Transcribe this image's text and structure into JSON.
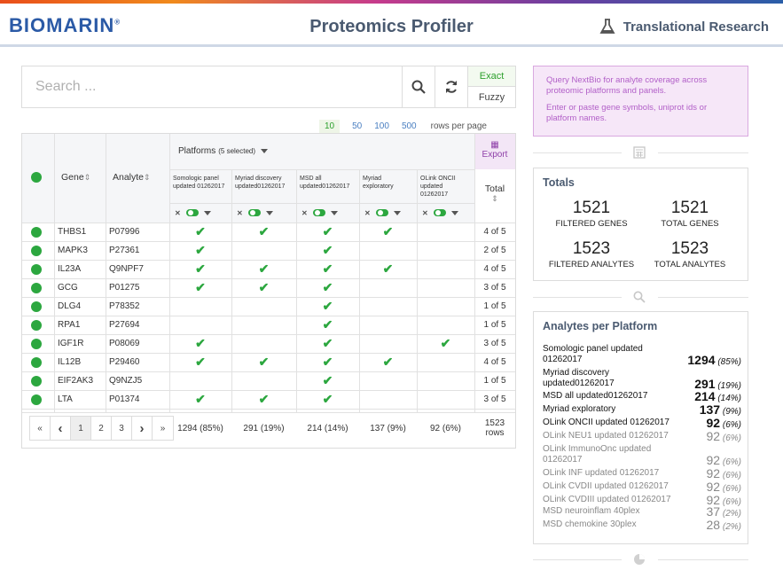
{
  "header": {
    "logo": "BIOMARIN",
    "logo_mark": "®",
    "title": "Proteomics Profiler",
    "right_label": "Translational Research"
  },
  "search": {
    "placeholder": "Search ...",
    "exact_label": "Exact",
    "fuzzy_label": "Fuzzy"
  },
  "rows_per_page": {
    "options": [
      "10",
      "50",
      "100",
      "500"
    ],
    "label": "rows per page"
  },
  "table": {
    "col_gene": "Gene",
    "col_analyte": "Analyte",
    "platforms_label": "Platforms",
    "platforms_selected": "(5 selected)",
    "export_label": "Export",
    "total_label": "Total",
    "platforms": [
      "Somologic panel updated 01262017",
      "Myriad discovery updated01262017",
      "MSD all updated01262017",
      "Myriad exploratory",
      "OLink ONCII updated 01262017"
    ],
    "rows": [
      {
        "gene": "THBS1",
        "analyte": "P07996",
        "checks": [
          1,
          1,
          1,
          1,
          0
        ],
        "total": "4 of 5"
      },
      {
        "gene": "MAPK3",
        "analyte": "P27361",
        "checks": [
          1,
          0,
          1,
          0,
          0
        ],
        "total": "2 of 5"
      },
      {
        "gene": "IL23A",
        "analyte": "Q9NPF7",
        "checks": [
          1,
          1,
          1,
          1,
          0
        ],
        "total": "4 of 5"
      },
      {
        "gene": "GCG",
        "analyte": "P01275",
        "checks": [
          1,
          1,
          1,
          0,
          0
        ],
        "total": "3 of 5"
      },
      {
        "gene": "DLG4",
        "analyte": "P78352",
        "checks": [
          0,
          0,
          1,
          0,
          0
        ],
        "total": "1 of 5"
      },
      {
        "gene": "RPA1",
        "analyte": "P27694",
        "checks": [
          0,
          0,
          1,
          0,
          0
        ],
        "total": "1 of 5"
      },
      {
        "gene": "IGF1R",
        "analyte": "P08069",
        "checks": [
          1,
          0,
          1,
          0,
          1
        ],
        "total": "3 of 5"
      },
      {
        "gene": "IL12B",
        "analyte": "P29460",
        "checks": [
          1,
          1,
          1,
          1,
          0
        ],
        "total": "4 of 5"
      },
      {
        "gene": "EIF2AK3",
        "analyte": "Q9NZJ5",
        "checks": [
          0,
          0,
          1,
          0,
          0
        ],
        "total": "1 of 5"
      },
      {
        "gene": "LTA",
        "analyte": "P01374",
        "checks": [
          1,
          1,
          1,
          0,
          0
        ],
        "total": "3 of 5"
      }
    ],
    "footer_counts": [
      "1294 (85%)",
      "291 (19%)",
      "214 (14%)",
      "137 (9%)",
      "92 (6%)"
    ],
    "footer_total": "1523",
    "footer_total_unit": "rows"
  },
  "pager": {
    "first": "«",
    "prev": "‹",
    "pages": [
      "1",
      "2",
      "3"
    ],
    "next": "›",
    "last": "»",
    "current": "1"
  },
  "info": {
    "line1": "Query NextBio for analyte coverage across proteomic platforms and panels.",
    "line2": "Enter or paste gene symbols, uniprot ids or platform names."
  },
  "totals": {
    "title": "Totals",
    "items": [
      {
        "value": "1521",
        "label": "FILTERED GENES"
      },
      {
        "value": "1521",
        "label": "TOTAL GENES"
      },
      {
        "value": "1523",
        "label": "FILTERED ANALYTES"
      },
      {
        "value": "1523",
        "label": "TOTAL ANALYTES"
      }
    ]
  },
  "analytes": {
    "title": "Analytes per Platform",
    "items": [
      {
        "name": "Somologic panel updated 01262017",
        "count": "1294",
        "pct": "(85%)",
        "selected": true
      },
      {
        "name": "Myriad discovery updated01262017",
        "count": "291",
        "pct": "(19%)",
        "selected": true
      },
      {
        "name": "MSD all updated01262017",
        "count": "214",
        "pct": "(14%)",
        "selected": true
      },
      {
        "name": "Myriad exploratory",
        "count": "137",
        "pct": "(9%)",
        "selected": true
      },
      {
        "name": "OLink ONCII updated 01262017",
        "count": "92",
        "pct": "(6%)",
        "selected": true
      },
      {
        "name": "OLink NEU1 updated 01262017",
        "count": "92",
        "pct": "(6%)",
        "selected": false
      },
      {
        "name": "OLink ImmunoOnc updated 01262017",
        "count": "92",
        "pct": "(6%)",
        "selected": false
      },
      {
        "name": "OLink INF updated 01262017",
        "count": "92",
        "pct": "(6%)",
        "selected": false
      },
      {
        "name": "OLink CVDII updated 01262017",
        "count": "92",
        "pct": "(6%)",
        "selected": false
      },
      {
        "name": "OLink CVDIII updated 01262017",
        "count": "92",
        "pct": "(6%)",
        "selected": false
      },
      {
        "name": "MSD neuroinflam 40plex",
        "count": "37",
        "pct": "(2%)",
        "selected": false
      },
      {
        "name": "MSD chemokine 30plex",
        "count": "28",
        "pct": "(2%)",
        "selected": false
      }
    ]
  },
  "colors": {
    "accent": "#2ca73f",
    "title": "#4a5a70",
    "info_bg": "#f6e7f8",
    "info_text": "#b260c8"
  },
  "icons": [
    "flask-icon",
    "search-icon",
    "refresh-icon",
    "calculator-icon",
    "magnifier-icon",
    "pie-icon",
    "table-icon"
  ]
}
